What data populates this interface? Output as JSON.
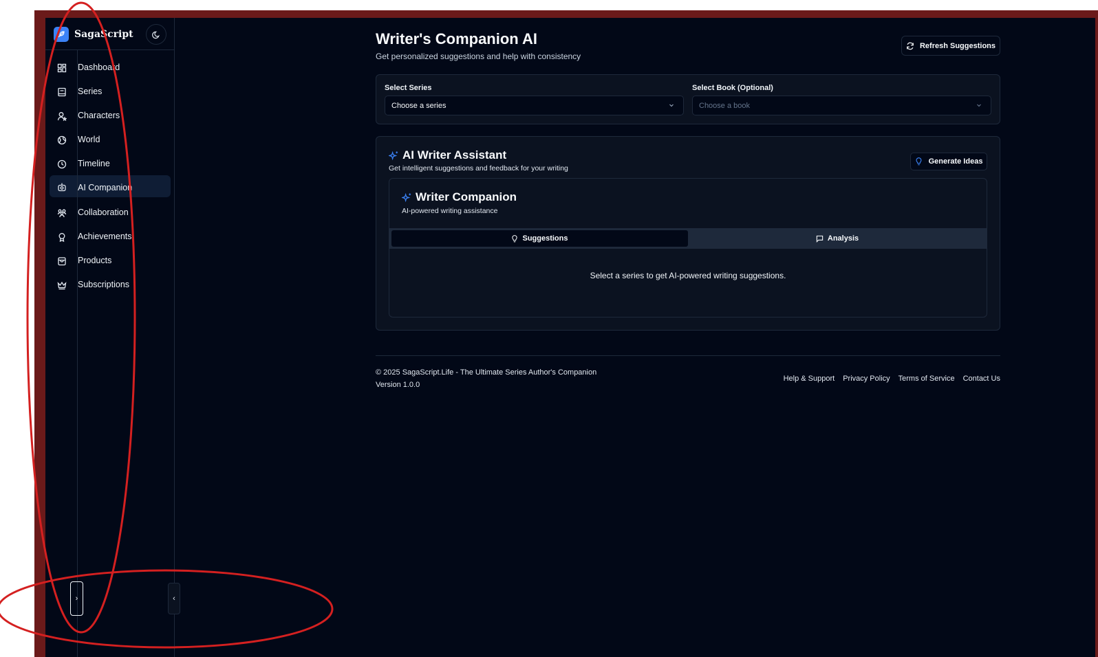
{
  "sidebar": {
    "brand_name": "SagaScript",
    "items": [
      {
        "label": "Dashboard",
        "icon": "dashboard-icon"
      },
      {
        "label": "Series",
        "icon": "book-icon"
      },
      {
        "label": "Characters",
        "icon": "user-star-icon"
      },
      {
        "label": "World",
        "icon": "globe-icon"
      },
      {
        "label": "Timeline",
        "icon": "clock-icon"
      },
      {
        "label": "AI Companion",
        "icon": "bot-icon",
        "active": true
      },
      {
        "label": "Collaboration",
        "icon": "users-icon"
      },
      {
        "label": "Achievements",
        "icon": "award-icon"
      },
      {
        "label": "Products",
        "icon": "package-icon"
      },
      {
        "label": "Subscriptions",
        "icon": "crown-icon"
      }
    ],
    "expand_glyph": "›",
    "collapse_glyph": "‹"
  },
  "header": {
    "title": "Writer's Companion AI",
    "subtitle": "Get personalized suggestions and help with consistency",
    "refresh_label": "Refresh Suggestions"
  },
  "selectors": {
    "series_label": "Select Series",
    "series_value": "Choose a series",
    "book_label": "Select Book (Optional)",
    "book_placeholder": "Choose a book"
  },
  "assistant": {
    "title": "AI Writer Assistant",
    "subtitle": "Get intelligent suggestions and feedback for your writing",
    "generate_label": "Generate Ideas",
    "companion": {
      "title": "Writer Companion",
      "subtitle": "AI-powered writing assistance",
      "tabs": [
        {
          "label": "Suggestions",
          "icon": "lightbulb-icon",
          "active": true
        },
        {
          "label": "Analysis",
          "icon": "message-square-icon",
          "active": false
        }
      ],
      "empty_message": "Select a series to get AI-powered writing suggestions."
    }
  },
  "footer": {
    "copyright": "© 2025 SagaScript.Life - The Ultimate Series Author's Companion",
    "version": "Version 1.0.0",
    "links": [
      "Help & Support",
      "Privacy Policy",
      "Terms of Service",
      "Contact Us"
    ]
  },
  "colors": {
    "background": "#020817",
    "card": "#0b1220",
    "border": "#1e293b",
    "accent": "#3b82f6",
    "annotation": "#d42020"
  }
}
